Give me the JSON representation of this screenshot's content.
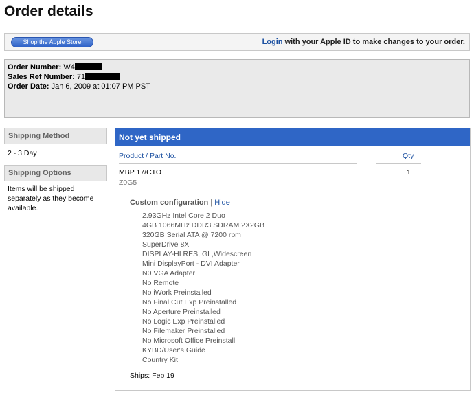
{
  "page": {
    "title": "Order details"
  },
  "topbar": {
    "store_button": "Shop the Apple Store",
    "login_link": "Login",
    "login_suffix": " with your Apple ID to make changes to your order."
  },
  "order": {
    "number_label": "Order Number:",
    "number_visible": "W4",
    "sales_ref_label": "Sales Ref Number:",
    "sales_ref_visible": "71",
    "date_label": "Order Date:",
    "date_value": "Jan 6, 2009 at 01:07 PM PST"
  },
  "sidebar": {
    "shipping_method_title": "Shipping Method",
    "shipping_method_value": "2 - 3 Day",
    "shipping_options_title": "Shipping Options",
    "shipping_options_text": "Items will be shipped separately as they become available."
  },
  "shipment": {
    "status": "Not yet shipped",
    "col_product": "Product / Part No.",
    "col_qty": "Qty",
    "product_name": "MBP 17/CTO",
    "part_number": "Z0G5",
    "quantity": "1",
    "config_label": "Custom configuration",
    "config_separator": " | ",
    "hide_link": "Hide",
    "config_items": [
      "2.93GHz Intel Core 2 Duo",
      "4GB 1066MHz DDR3 SDRAM 2X2GB",
      "320GB Serial ATA @ 7200 rpm",
      "SuperDrive 8X",
      "DISPLAY-HI RES, GL,Widescreen",
      "Mini DisplayPort - DVI Adapter",
      "N0 VGA Adapter",
      "No Remote",
      "No iWork Preinstalled",
      "No Final Cut Exp Preinstalled",
      "No Aperture Preinstalled",
      "No Logic Exp Preinstalled",
      "No Filemaker Preinstalled",
      "No Microsoft Office Preinstall",
      "KYBD/User's Guide",
      "Country Kit"
    ],
    "ships_text": "Ships: Feb 19"
  }
}
